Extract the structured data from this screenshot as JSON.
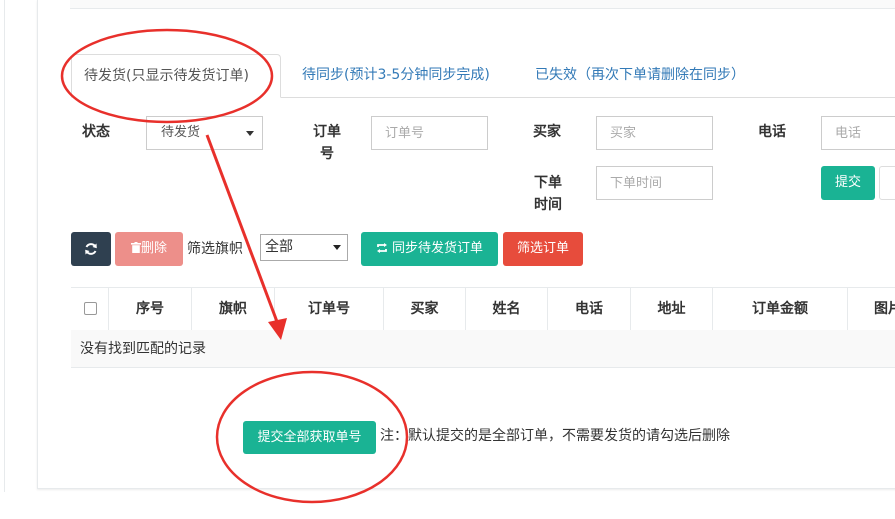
{
  "tabs": [
    {
      "label": "待发货(只显示待发货订单)",
      "active": true
    },
    {
      "label": "待同步(预计3-5分钟同步完成)",
      "active": false
    },
    {
      "label": "已失效（再次下单请删除在同步）",
      "active": false
    }
  ],
  "filters": {
    "status_label": "状态",
    "status_value": "待发货",
    "order_no_label": "订单号",
    "order_no_placeholder": "订单号",
    "buyer_label": "买家",
    "buyer_placeholder": "买家",
    "phone_label": "电话",
    "phone_placeholder": "电话",
    "order_time_label": "下单时间",
    "order_time_placeholder": "下单时间",
    "submit_label": "提交"
  },
  "toolbar": {
    "refresh_icon": "refresh-icon",
    "delete_label": "删除",
    "flag_filter_label": "筛选旗帜",
    "flag_filter_value": "全部",
    "sync_label": "同步待发货订单",
    "filter_orders_label": "筛选订单"
  },
  "table": {
    "columns": [
      "序号",
      "旗帜",
      "订单号",
      "买家",
      "姓名",
      "电话",
      "地址",
      "订单金额",
      "图片"
    ],
    "empty_text": "没有找到匹配的记录"
  },
  "footer": {
    "submit_all_label": "提交全部获取单号",
    "note": "注：默认提交的是全部订单，不需要发货的请勾选后删除"
  },
  "colors": {
    "teal": "#1ab394",
    "dark": "#2f4050",
    "red": "#e74c3c",
    "pink": "#ed8f8a",
    "annotation": "#e8302b",
    "link": "#337ab7"
  }
}
